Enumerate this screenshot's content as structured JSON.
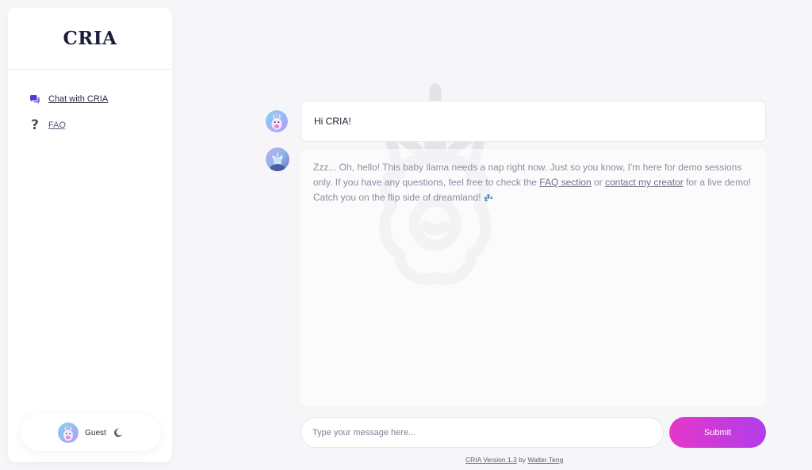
{
  "sidebar": {
    "brand": "CRIA",
    "items": [
      {
        "label": "Chat with CRIA",
        "icon": "chat-bubbles-icon"
      },
      {
        "label": "FAQ",
        "icon": "question-mark-icon"
      }
    ],
    "user": {
      "name": "Guest",
      "theme_icon": "moon-icon"
    }
  },
  "chat": {
    "user_message": "Hi CRIA!",
    "bot_message": {
      "part1": "Zzz... Oh, hello! This baby llama needs a nap right now. Just so you know, I'm here for demo sessions only. If you have any questions, feel free to check the ",
      "link1": "FAQ section",
      "part2": " or ",
      "link2": "contact my creator",
      "part3": " for a live demo! Catch you on the flip side of dreamland! ",
      "emoji": "💤"
    }
  },
  "composer": {
    "placeholder": "Type your message here...",
    "submit_label": "Submit"
  },
  "footer": {
    "version_link": "CRIA Version 1.3",
    "by_text": " by ",
    "author_link": "Walter Teng"
  },
  "colors": {
    "accent_start": "#e438c8",
    "accent_end": "#b13dea",
    "brand_text": "#1b1d3a",
    "chat_icon": "#4b3fd6"
  }
}
